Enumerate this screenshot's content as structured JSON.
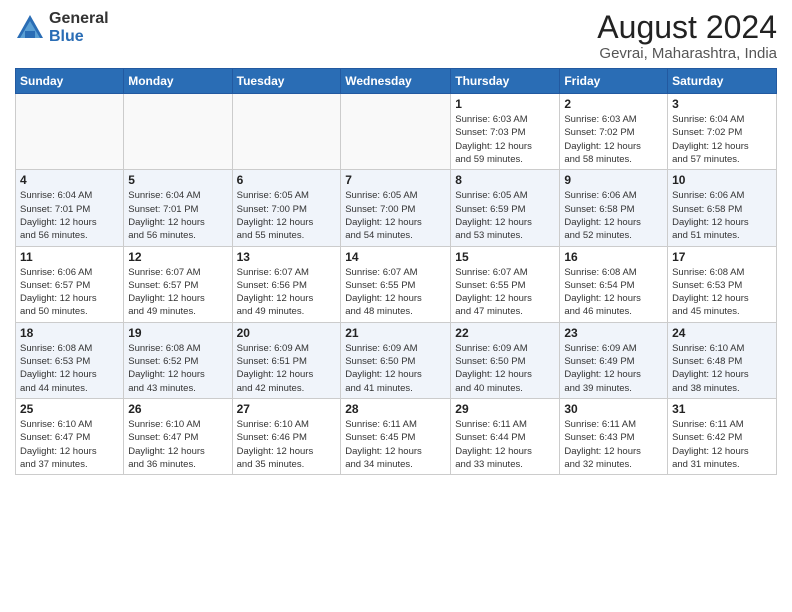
{
  "logo": {
    "general": "General",
    "blue": "Blue"
  },
  "title": "August 2024",
  "subtitle": "Gevrai, Maharashtra, India",
  "weekdays": [
    "Sunday",
    "Monday",
    "Tuesday",
    "Wednesday",
    "Thursday",
    "Friday",
    "Saturday"
  ],
  "weeks": [
    [
      {
        "day": "",
        "info": ""
      },
      {
        "day": "",
        "info": ""
      },
      {
        "day": "",
        "info": ""
      },
      {
        "day": "",
        "info": ""
      },
      {
        "day": "1",
        "info": "Sunrise: 6:03 AM\nSunset: 7:03 PM\nDaylight: 12 hours\nand 59 minutes."
      },
      {
        "day": "2",
        "info": "Sunrise: 6:03 AM\nSunset: 7:02 PM\nDaylight: 12 hours\nand 58 minutes."
      },
      {
        "day": "3",
        "info": "Sunrise: 6:04 AM\nSunset: 7:02 PM\nDaylight: 12 hours\nand 57 minutes."
      }
    ],
    [
      {
        "day": "4",
        "info": "Sunrise: 6:04 AM\nSunset: 7:01 PM\nDaylight: 12 hours\nand 56 minutes."
      },
      {
        "day": "5",
        "info": "Sunrise: 6:04 AM\nSunset: 7:01 PM\nDaylight: 12 hours\nand 56 minutes."
      },
      {
        "day": "6",
        "info": "Sunrise: 6:05 AM\nSunset: 7:00 PM\nDaylight: 12 hours\nand 55 minutes."
      },
      {
        "day": "7",
        "info": "Sunrise: 6:05 AM\nSunset: 7:00 PM\nDaylight: 12 hours\nand 54 minutes."
      },
      {
        "day": "8",
        "info": "Sunrise: 6:05 AM\nSunset: 6:59 PM\nDaylight: 12 hours\nand 53 minutes."
      },
      {
        "day": "9",
        "info": "Sunrise: 6:06 AM\nSunset: 6:58 PM\nDaylight: 12 hours\nand 52 minutes."
      },
      {
        "day": "10",
        "info": "Sunrise: 6:06 AM\nSunset: 6:58 PM\nDaylight: 12 hours\nand 51 minutes."
      }
    ],
    [
      {
        "day": "11",
        "info": "Sunrise: 6:06 AM\nSunset: 6:57 PM\nDaylight: 12 hours\nand 50 minutes."
      },
      {
        "day": "12",
        "info": "Sunrise: 6:07 AM\nSunset: 6:57 PM\nDaylight: 12 hours\nand 49 minutes."
      },
      {
        "day": "13",
        "info": "Sunrise: 6:07 AM\nSunset: 6:56 PM\nDaylight: 12 hours\nand 49 minutes."
      },
      {
        "day": "14",
        "info": "Sunrise: 6:07 AM\nSunset: 6:55 PM\nDaylight: 12 hours\nand 48 minutes."
      },
      {
        "day": "15",
        "info": "Sunrise: 6:07 AM\nSunset: 6:55 PM\nDaylight: 12 hours\nand 47 minutes."
      },
      {
        "day": "16",
        "info": "Sunrise: 6:08 AM\nSunset: 6:54 PM\nDaylight: 12 hours\nand 46 minutes."
      },
      {
        "day": "17",
        "info": "Sunrise: 6:08 AM\nSunset: 6:53 PM\nDaylight: 12 hours\nand 45 minutes."
      }
    ],
    [
      {
        "day": "18",
        "info": "Sunrise: 6:08 AM\nSunset: 6:53 PM\nDaylight: 12 hours\nand 44 minutes."
      },
      {
        "day": "19",
        "info": "Sunrise: 6:08 AM\nSunset: 6:52 PM\nDaylight: 12 hours\nand 43 minutes."
      },
      {
        "day": "20",
        "info": "Sunrise: 6:09 AM\nSunset: 6:51 PM\nDaylight: 12 hours\nand 42 minutes."
      },
      {
        "day": "21",
        "info": "Sunrise: 6:09 AM\nSunset: 6:50 PM\nDaylight: 12 hours\nand 41 minutes."
      },
      {
        "day": "22",
        "info": "Sunrise: 6:09 AM\nSunset: 6:50 PM\nDaylight: 12 hours\nand 40 minutes."
      },
      {
        "day": "23",
        "info": "Sunrise: 6:09 AM\nSunset: 6:49 PM\nDaylight: 12 hours\nand 39 minutes."
      },
      {
        "day": "24",
        "info": "Sunrise: 6:10 AM\nSunset: 6:48 PM\nDaylight: 12 hours\nand 38 minutes."
      }
    ],
    [
      {
        "day": "25",
        "info": "Sunrise: 6:10 AM\nSunset: 6:47 PM\nDaylight: 12 hours\nand 37 minutes."
      },
      {
        "day": "26",
        "info": "Sunrise: 6:10 AM\nSunset: 6:47 PM\nDaylight: 12 hours\nand 36 minutes."
      },
      {
        "day": "27",
        "info": "Sunrise: 6:10 AM\nSunset: 6:46 PM\nDaylight: 12 hours\nand 35 minutes."
      },
      {
        "day": "28",
        "info": "Sunrise: 6:11 AM\nSunset: 6:45 PM\nDaylight: 12 hours\nand 34 minutes."
      },
      {
        "day": "29",
        "info": "Sunrise: 6:11 AM\nSunset: 6:44 PM\nDaylight: 12 hours\nand 33 minutes."
      },
      {
        "day": "30",
        "info": "Sunrise: 6:11 AM\nSunset: 6:43 PM\nDaylight: 12 hours\nand 32 minutes."
      },
      {
        "day": "31",
        "info": "Sunrise: 6:11 AM\nSunset: 6:42 PM\nDaylight: 12 hours\nand 31 minutes."
      }
    ]
  ]
}
